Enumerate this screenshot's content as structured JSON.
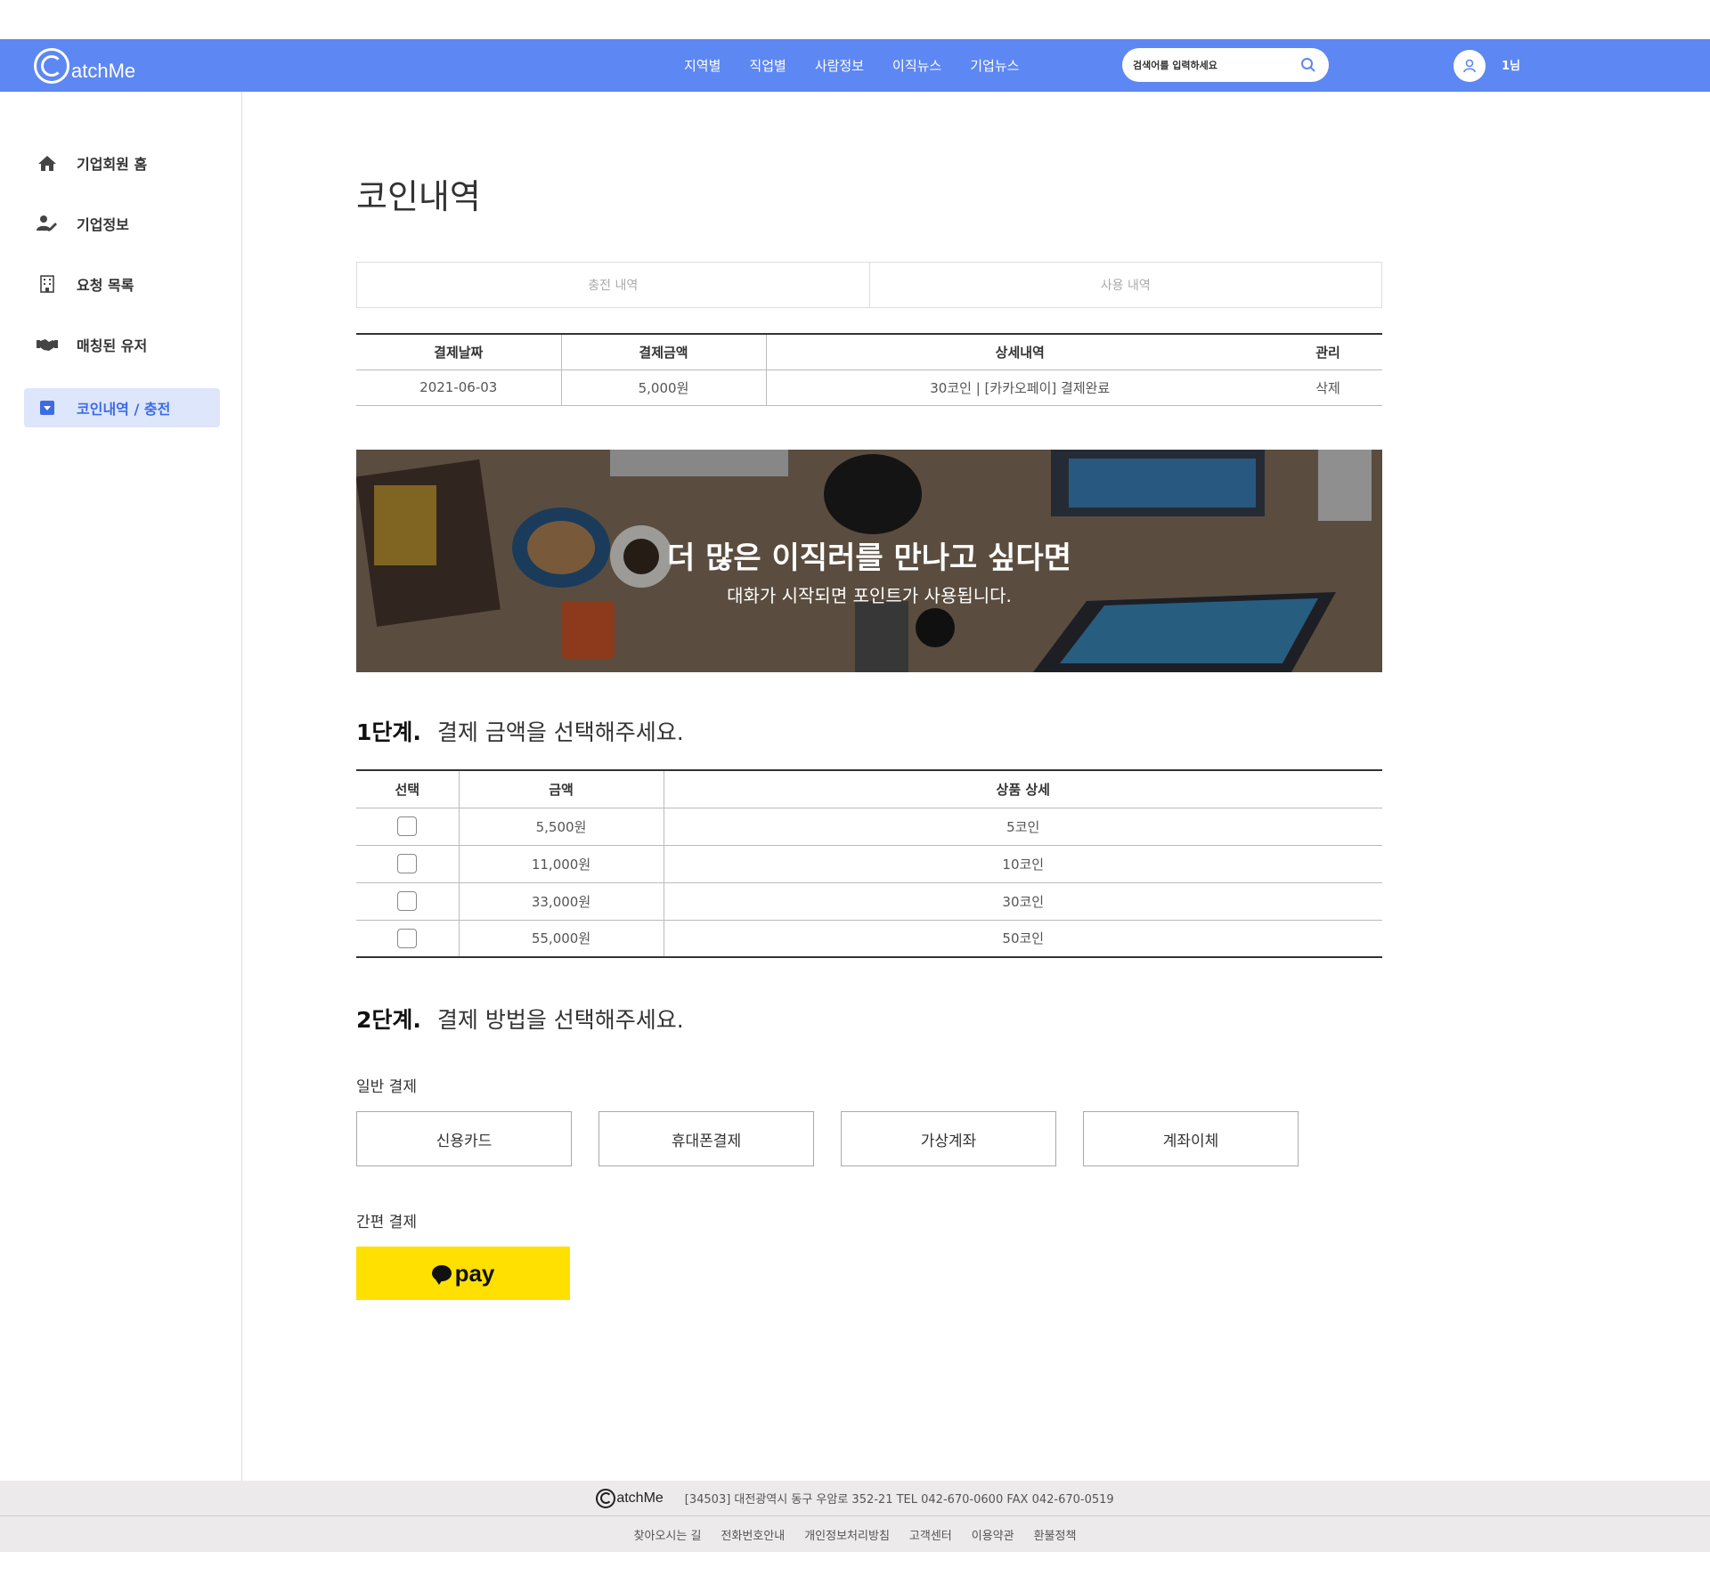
{
  "header": {
    "logo_text": "atchMe",
    "nav": [
      "지역별",
      "직업별",
      "사람정보",
      "이직뉴스",
      "기업뉴스"
    ],
    "search_placeholder": "검색어를 입력하세요",
    "user_name": "1님",
    "accent_color": "#5d87f2"
  },
  "sidebar": {
    "items": [
      {
        "label": "기업회원 홈",
        "icon": "home-icon"
      },
      {
        "label": "기업정보",
        "icon": "user-edit-icon"
      },
      {
        "label": "요청 목록",
        "icon": "building-icon"
      },
      {
        "label": "매칭된 유저",
        "icon": "handshake-icon"
      },
      {
        "label": "코인내역 / 충전",
        "icon": "dropdown-box-icon",
        "active": true
      }
    ]
  },
  "main": {
    "title": "코인내역",
    "tabs": [
      "충전 내역",
      "사용 내역"
    ],
    "history": {
      "headers": [
        "결제날짜",
        "결제금액",
        "상세내역",
        "관리"
      ],
      "rows": [
        {
          "date": "2021-06-03",
          "amount": "5,000원",
          "detail": "30코인 | [카카오페이] 결제완료",
          "action": "삭제"
        }
      ]
    },
    "banner": {
      "headline": "더 많은 이직러를 만나고 싶다면",
      "subline": "대화가 시작되면 포인트가 사용됩니다."
    },
    "step1": {
      "label": "1단계.",
      "text": "결제 금액을 선택해주세요."
    },
    "products": {
      "headers": [
        "선택",
        "금액",
        "상품 상세"
      ],
      "rows": [
        {
          "price": "5,500원",
          "detail": "5코인"
        },
        {
          "price": "11,000원",
          "detail": "10코인"
        },
        {
          "price": "33,000원",
          "detail": "30코인"
        },
        {
          "price": "55,000원",
          "detail": "50코인"
        }
      ]
    },
    "step2": {
      "label": "2단계.",
      "text": "결제 방법을 선택해주세요."
    },
    "general_payment": {
      "label": "일반 결제",
      "methods": [
        "신용카드",
        "휴대폰결제",
        "가상계좌",
        "계좌이체"
      ]
    },
    "simple_payment": {
      "label": "간편 결제",
      "kakaopay_text": "pay",
      "kakaopay_color": "#ffe000"
    }
  },
  "footer": {
    "logo_text": "atchMe",
    "address": "[34503] 대전광역시 동구 우암로 352-21 TEL 042-670-0600 FAX 042-670-0519",
    "links": [
      "찾아오시는 길",
      "전화번호안내",
      "개인정보처리방침",
      "고객센터",
      "이용약관",
      "환불정책"
    ]
  }
}
